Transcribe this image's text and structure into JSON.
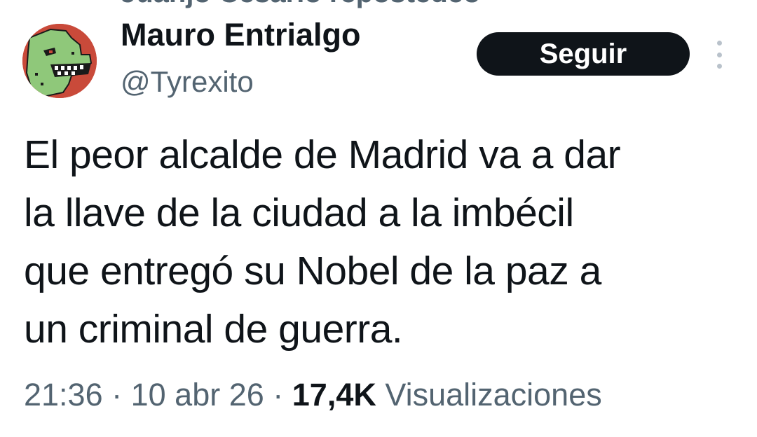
{
  "repost_banner": {
    "text": "Juanjo Cesario repostedeo"
  },
  "author": {
    "display_name": "Mauro Entrialgo",
    "handle": "@Tyrexito",
    "avatar_icon": "dinosaur-avatar-icon"
  },
  "actions": {
    "follow_label": "Seguir",
    "more_icon": "more-vertical-icon"
  },
  "tweet": {
    "text": "El peor alcalde de Madrid va a dar\nla llave de la ciudad a la imbécil\nque entregó su Nobel de la paz a\nun criminal de guerra."
  },
  "meta": {
    "time": "21:36",
    "separator": " · ",
    "date": "10 abr 26",
    "views_count": "17,4K",
    "views_label": " Visualizaciones"
  },
  "colors": {
    "text_primary": "#0f1419",
    "text_secondary": "#536471",
    "button_bg": "#0f1419",
    "button_text": "#ffffff",
    "avatar_bg": "#c94a3a",
    "avatar_dino": "#8fc87a"
  }
}
